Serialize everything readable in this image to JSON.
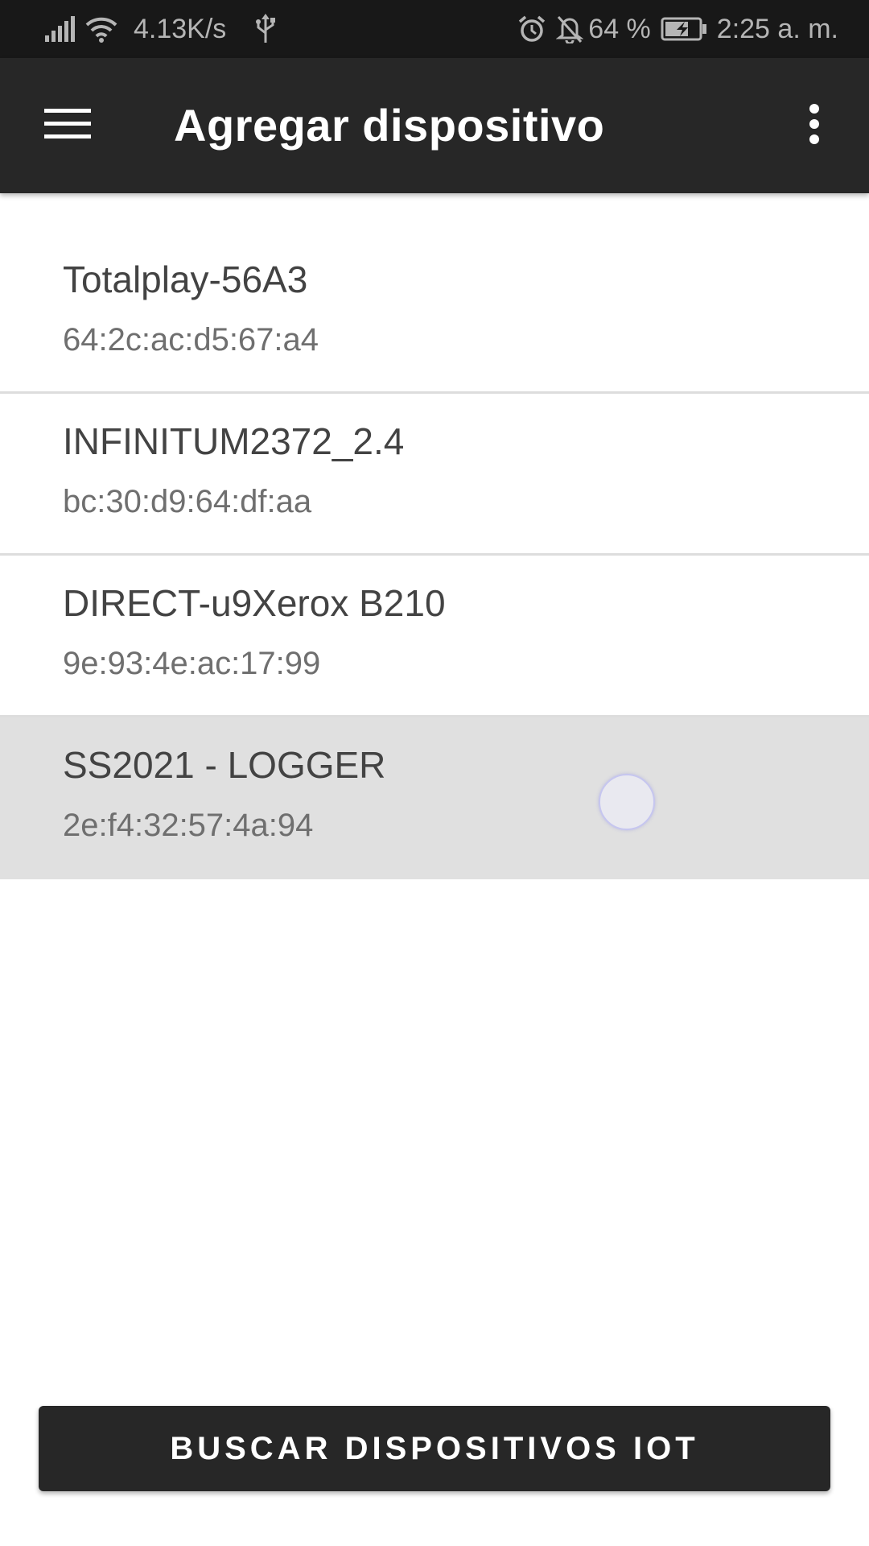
{
  "status_bar": {
    "network_speed": "4.13K/s",
    "battery_percent": "64 %",
    "time": "2:25 a. m.",
    "icons": [
      "signal-icon",
      "wifi-icon",
      "usb-icon",
      "alarm-icon",
      "notifications-off-icon",
      "battery-charging-icon"
    ]
  },
  "toolbar": {
    "title": "Agregar dispositivo",
    "menu_icon": "hamburger-menu-icon",
    "overflow_icon": "more-vertical-icon"
  },
  "devices": [
    {
      "name": "Totalplay-56A3",
      "mac": "64:2c:ac:d5:67:a4"
    },
    {
      "name": "INFINITUM2372_2.4",
      "mac": "bc:30:d9:64:df:aa"
    },
    {
      "name": "DIRECT-u9Xerox B210",
      "mac": "9e:93:4e:ac:17:99"
    },
    {
      "name": "SS2021 - LOGGER",
      "mac": "2e:f4:32:57:4a:94",
      "pressed": true
    }
  ],
  "scan_button": {
    "label": "BUSCAR DISPOSITIVOS IOT"
  },
  "colors": {
    "toolbar": "#272727",
    "status_bar": "#181818",
    "pressed_row": "#e0e0e0",
    "divider": "#dddddd"
  }
}
